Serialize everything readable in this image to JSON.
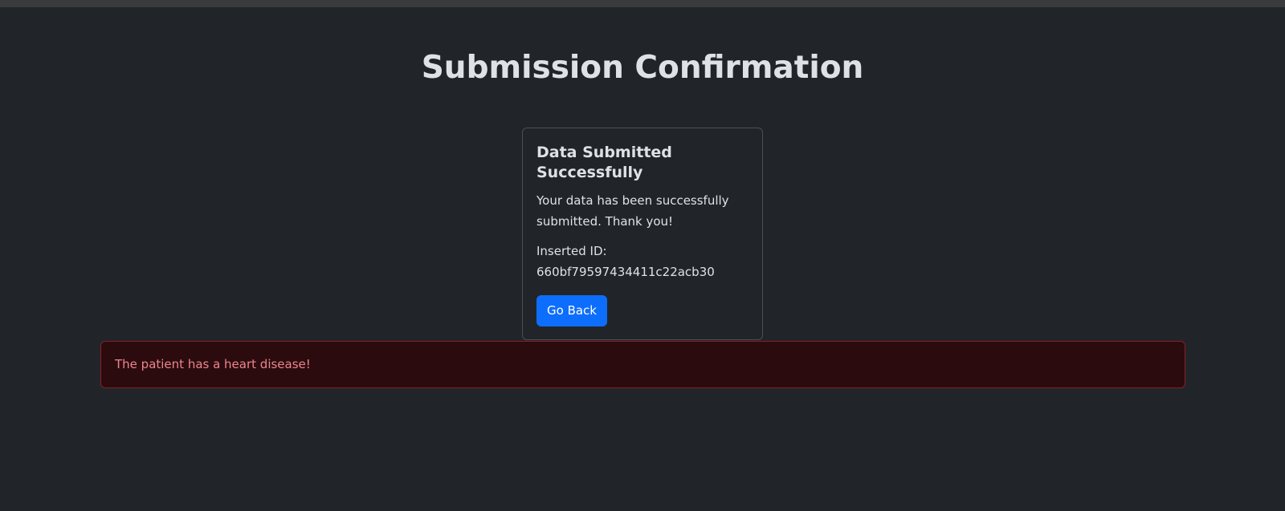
{
  "page": {
    "title": "Submission Confirmation"
  },
  "card": {
    "title": "Data Submitted Successfully",
    "message": "Your data has been successfully submitted. Thank you!",
    "id_label": "Inserted ID:",
    "id_value": "660bf79597434411c22acb30",
    "back_button_label": "Go Back"
  },
  "alert": {
    "message": "The patient has a heart disease!"
  },
  "colors": {
    "background": "#212529",
    "primary_button": "#0d6efd",
    "danger_text": "#ea868f",
    "danger_background": "#2c0b0e",
    "danger_border": "#842029"
  }
}
